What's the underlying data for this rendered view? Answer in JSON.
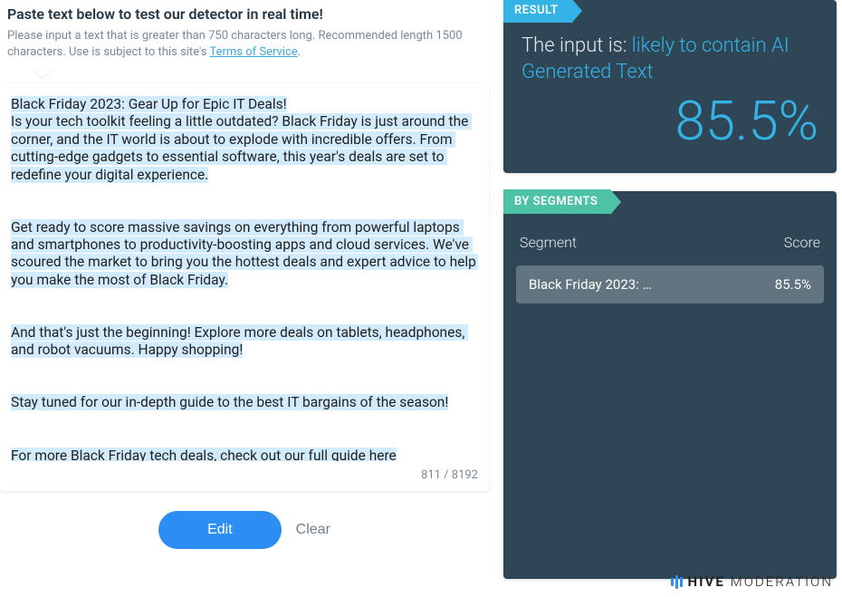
{
  "header": {
    "title": "Paste text below to test our detector in real time!",
    "desc_pre": "Please input a text that is greater than 750 characters long. Recommended length 1500 characters. Use is subject to this site's ",
    "tos": "Terms of Service",
    "desc_post": "."
  },
  "input": {
    "lines": [
      "Black Friday 2023: Gear Up for Epic IT Deals!",
      "Is your tech toolkit feeling a little outdated? Black Friday is just around the corner, and the IT world is about to explode with incredible offers. From cutting-edge gadgets to essential software, this year's deals are set to redefine your digital experience.",
      "",
      "Get ready to score massive savings on everything from powerful laptops and smartphones to productivity-boosting apps and cloud services. We've scoured the market to bring you the hottest deals and expert advice to help you make the most of Black Friday.",
      "",
      "And that's just the beginning! Explore more deals on tablets, headphones, and robot vacuums. Happy shopping!",
      "",
      "Stay tuned for our in-depth guide to the best IT bargains of the season!",
      "",
      "For more Black Friday tech deals, check out our full guide here"
    ],
    "counter": "811 / 8192"
  },
  "actions": {
    "edit": "Edit",
    "clear": "Clear"
  },
  "result": {
    "tag": "RESULT",
    "prefix": "The input is: ",
    "verdict": "likely to contain AI Generated Text",
    "percent": "85.5%"
  },
  "segments": {
    "tag": "BY SEGMENTS",
    "col_segment": "Segment",
    "col_score": "Score",
    "rows": [
      {
        "name": "Black Friday 2023: …",
        "score": "85.5%"
      }
    ]
  },
  "brand": {
    "strong": "HIVE",
    "light": "MODERATION"
  }
}
